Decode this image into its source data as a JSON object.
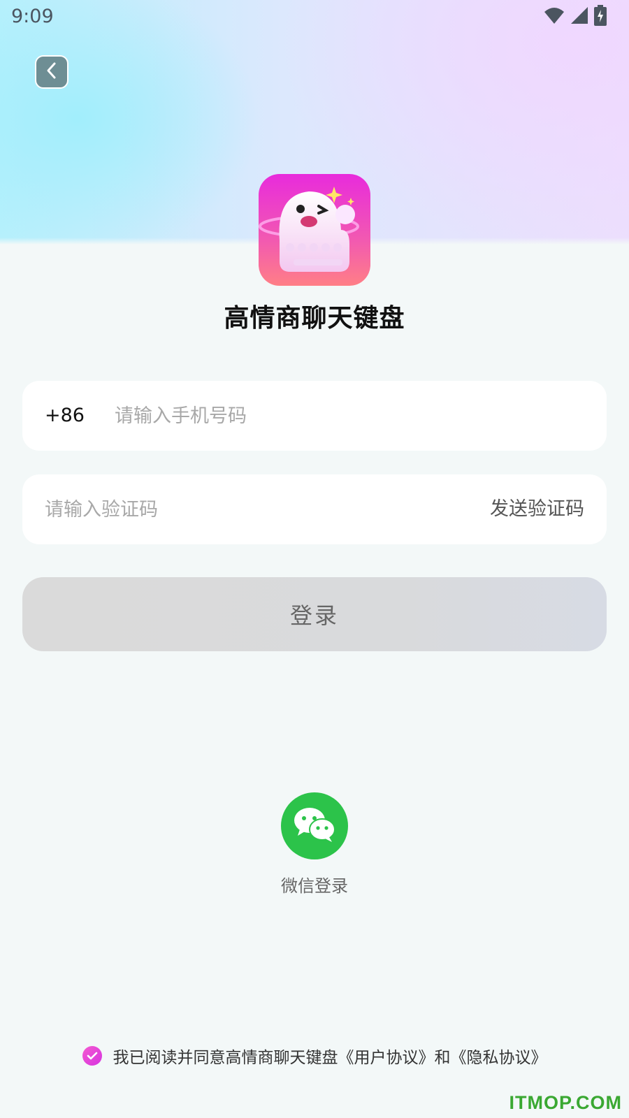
{
  "status_bar": {
    "time": "9:09",
    "icons": [
      "wifi-icon",
      "cellular-signal-icon",
      "battery-charging-icon"
    ]
  },
  "header": {
    "back_icon": "chevron-left-icon"
  },
  "app": {
    "name": "高情商聊天键盘",
    "logo_icon": "ghost-keyboard-logo"
  },
  "form": {
    "phone_prefix": "+86",
    "phone_placeholder": "请输入手机号码",
    "code_placeholder": "请输入验证码",
    "send_code_label": "发送验证码",
    "login_label": "登录"
  },
  "social": {
    "wechat_icon": "wechat-icon",
    "wechat_label": "微信登录",
    "wechat_color": "#2cc34a"
  },
  "agreement": {
    "checked": true,
    "prefix": "我已阅读并同意高情商聊天键盘",
    "user_agreement": "《用户协议》",
    "conjunction": "和",
    "privacy_policy": "《隐私协议》"
  },
  "watermark": "ITMOP.COM",
  "colors": {
    "accent": "#e82bdc",
    "background": "#f3f8f8"
  }
}
